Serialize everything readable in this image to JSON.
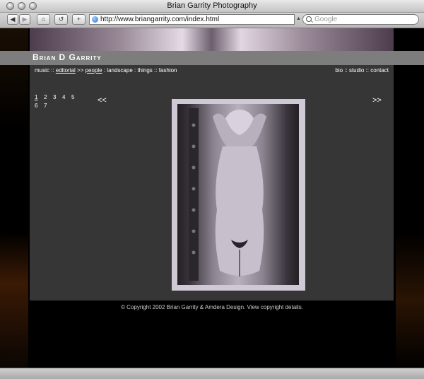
{
  "window": {
    "title": "Brian Garrity Photography"
  },
  "toolbar": {
    "back_glyph": "◀",
    "forward_glyph": "▶",
    "home_glyph": "⌂",
    "reload_glyph": "↺",
    "add_glyph": "+",
    "url": "http://www.briangarrity.com/index.html",
    "search_placeholder": "Google"
  },
  "site": {
    "brand": "Brian D Garrity",
    "nav_left": {
      "music": "music",
      "sep1": " :: ",
      "editorial": "editorial",
      "sep2": " >> ",
      "people": "people",
      "sep3": " : ",
      "landscape": "landscape",
      "sep4": " : ",
      "things": "things",
      "sep5": " :: ",
      "fashion": "fashion"
    },
    "nav_right": {
      "bio": "bio",
      "sep1": " :: ",
      "studio": "studio",
      "sep2": " :: ",
      "contact": "contact"
    },
    "pages": [
      "1",
      "2",
      "3",
      "4",
      "5",
      "6",
      "7"
    ],
    "current_page": "1",
    "prev": "<<",
    "next": ">>",
    "footer": "© Copyright 2002 Brian Garrity & Amdera Design. View copyright details."
  },
  "colors": {
    "content_bg": "#363636",
    "namebar_bg": "#7d7d7d",
    "page_bg": "#000000"
  }
}
